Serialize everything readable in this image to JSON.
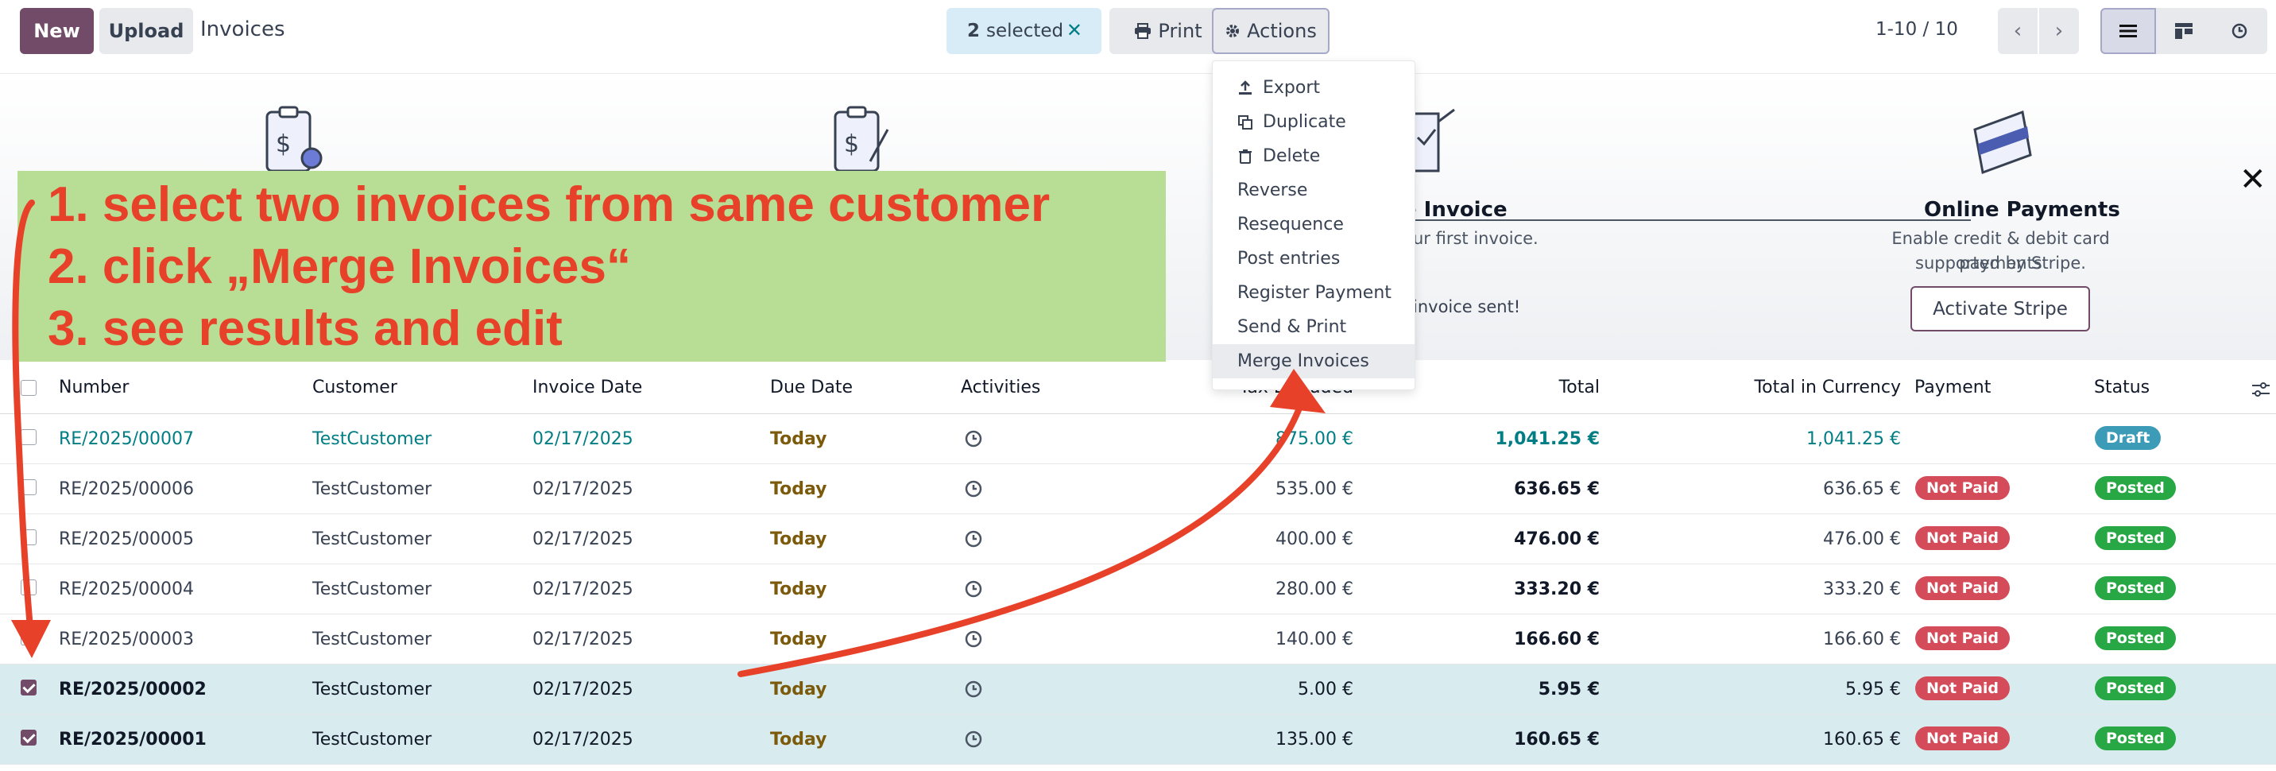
{
  "toolbar": {
    "new_label": "New",
    "upload_label": "Upload",
    "title": "Invoices",
    "selected_count": "2",
    "selected_text": "selected",
    "print_label": "Print",
    "actions_label": "Actions",
    "pager": "1-10 / 10"
  },
  "actions_menu": [
    {
      "label": "Export",
      "icon": "export-icon"
    },
    {
      "label": "Duplicate",
      "icon": "duplicate-icon"
    },
    {
      "label": "Delete",
      "icon": "trash-icon"
    },
    {
      "label": "Reverse",
      "icon": ""
    },
    {
      "label": "Resequence",
      "icon": ""
    },
    {
      "label": "Post entries",
      "icon": ""
    },
    {
      "label": "Register Payment",
      "icon": ""
    },
    {
      "label": "Send & Print",
      "icon": ""
    },
    {
      "label": "Merge Invoices",
      "icon": "",
      "active": true
    }
  ],
  "banner": {
    "step3_title": "e Invoice",
    "step3_text": "ur first invoice.",
    "step3_status": "invoice sent!",
    "step4_title": "Online Payments",
    "step4_text_1": "Enable credit & debit card payments",
    "step4_text_2": "supported by Stripe.",
    "stripe_button": "Activate Stripe"
  },
  "instructions": [
    "1. select two invoices from same customer",
    "2. click „Merge Invoices“",
    "3. see results and edit"
  ],
  "table": {
    "columns": {
      "number": "Number",
      "customer": "Customer",
      "invoice_date": "Invoice Date",
      "due_date": "Due Date",
      "activities": "Activities",
      "tax_excluded": "Tax Excluded",
      "total": "Total",
      "total_currency": "Total in Currency",
      "payment": "Payment",
      "status": "Status"
    },
    "rows": [
      {
        "number": "RE/2025/00007",
        "customer": "TestCustomer",
        "invoice_date": "02/17/2025",
        "due": "Today",
        "tax_excl": "875.00 €",
        "total": "1,041.25 €",
        "total_cur": "1,041.25 €",
        "payment": "",
        "status": "Draft",
        "selected": false
      },
      {
        "number": "RE/2025/00006",
        "customer": "TestCustomer",
        "invoice_date": "02/17/2025",
        "due": "Today",
        "tax_excl": "535.00 €",
        "total": "636.65 €",
        "total_cur": "636.65 €",
        "payment": "Not Paid",
        "status": "Posted",
        "selected": false
      },
      {
        "number": "RE/2025/00005",
        "customer": "TestCustomer",
        "invoice_date": "02/17/2025",
        "due": "Today",
        "tax_excl": "400.00 €",
        "total": "476.00 €",
        "total_cur": "476.00 €",
        "payment": "Not Paid",
        "status": "Posted",
        "selected": false
      },
      {
        "number": "RE/2025/00004",
        "customer": "TestCustomer",
        "invoice_date": "02/17/2025",
        "due": "Today",
        "tax_excl": "280.00 €",
        "total": "333.20 €",
        "total_cur": "333.20 €",
        "payment": "Not Paid",
        "status": "Posted",
        "selected": false
      },
      {
        "number": "RE/2025/00003",
        "customer": "TestCustomer",
        "invoice_date": "02/17/2025",
        "due": "Today",
        "tax_excl": "140.00 €",
        "total": "166.60 €",
        "total_cur": "166.60 €",
        "payment": "Not Paid",
        "status": "Posted",
        "selected": false
      },
      {
        "number": "RE/2025/00002",
        "customer": "TestCustomer",
        "invoice_date": "02/17/2025",
        "due": "Today",
        "tax_excl": "5.00 €",
        "total": "5.95 €",
        "total_cur": "5.95 €",
        "payment": "Not Paid",
        "status": "Posted",
        "selected": true
      },
      {
        "number": "RE/2025/00001",
        "customer": "TestCustomer",
        "invoice_date": "02/17/2025",
        "due": "Today",
        "tax_excl": "135.00 €",
        "total": "160.65 €",
        "total_cur": "160.65 €",
        "payment": "Not Paid",
        "status": "Posted",
        "selected": true
      }
    ]
  },
  "colors": {
    "primary": "#714b67",
    "link": "#017e84",
    "not_paid": "#d44c59",
    "posted": "#28a745",
    "draft": "#3c9bb7",
    "annotation": "#e8412a",
    "note_bg": "#b8dd95"
  }
}
